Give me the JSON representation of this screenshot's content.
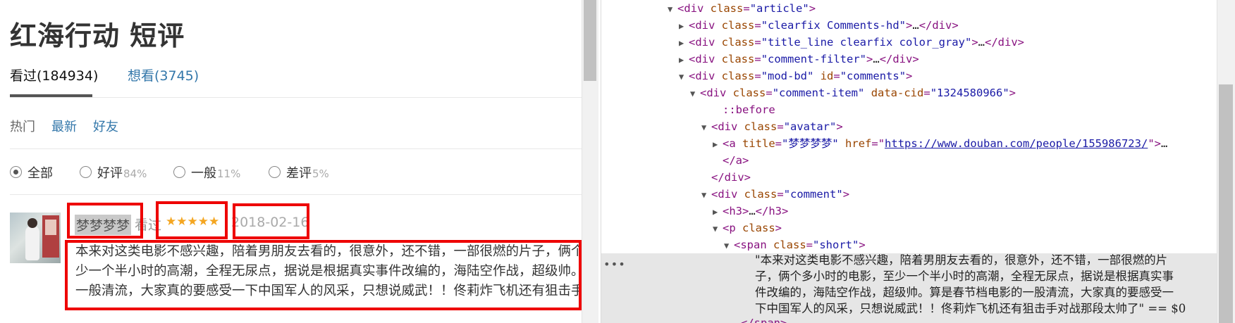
{
  "page": {
    "title": "红海行动 短评",
    "tabs": [
      {
        "label": "看过(184934)",
        "active": true
      },
      {
        "label": "想看(3745)",
        "active": false
      }
    ],
    "sort_links": [
      "热门",
      "最新",
      "好友"
    ],
    "filters": [
      {
        "label": "全部",
        "pct": "",
        "selected": true
      },
      {
        "label": "好评",
        "pct": "84%",
        "selected": false
      },
      {
        "label": "一般",
        "pct": "11%",
        "selected": false
      },
      {
        "label": "差评",
        "pct": "5%",
        "selected": false
      }
    ]
  },
  "comment": {
    "user": "梦梦梦梦",
    "status": "看过",
    "rating": 5,
    "rating_max": 5,
    "stars": "★★★★★",
    "date": "2018-02-16",
    "text_lines": [
      "本来对这类电影不感兴趣，陪着男朋友去看的，很意外，还不错，一部很燃的片子，俩个多小时的电影，至",
      "少一个半小时的高潮，全程无尿点，据说是根据真实事件改编的，海陆空作战，超级帅。算是春节档电影的",
      "一般清流，大家真的要感受一下中国军人的风采，只想说威武！！佟莉炸飞机还有狙击手对战那段太帅了"
    ]
  },
  "devtools": {
    "lines": [
      {
        "tri": "▼",
        "parts": [
          [
            "tag",
            "<div "
          ],
          [
            "an",
            "class"
          ],
          [
            "tag",
            "="
          ],
          [
            "av",
            "\"article\""
          ],
          [
            "tag",
            ">"
          ]
        ]
      },
      {
        "tri": "▶",
        "parts": [
          [
            "tag",
            "<div "
          ],
          [
            "an",
            "class"
          ],
          [
            "tag",
            "="
          ],
          [
            "av",
            "\"clearfix Comments-hd\""
          ],
          [
            "tag",
            ">"
          ],
          [
            "txt",
            "…"
          ],
          [
            "tag",
            "</div>"
          ]
        ]
      },
      {
        "tri": "▶",
        "parts": [
          [
            "tag",
            "<div "
          ],
          [
            "an",
            "class"
          ],
          [
            "tag",
            "="
          ],
          [
            "av",
            "\"title_line clearfix color_gray\""
          ],
          [
            "tag",
            ">"
          ],
          [
            "txt",
            "…"
          ],
          [
            "tag",
            "</div>"
          ]
        ]
      },
      {
        "tri": "▶",
        "parts": [
          [
            "tag",
            "<div "
          ],
          [
            "an",
            "class"
          ],
          [
            "tag",
            "="
          ],
          [
            "av",
            "\"comment-filter\""
          ],
          [
            "tag",
            ">"
          ],
          [
            "txt",
            "…"
          ],
          [
            "tag",
            "</div>"
          ]
        ]
      },
      {
        "tri": "▼",
        "parts": [
          [
            "tag",
            "<div "
          ],
          [
            "an",
            "class"
          ],
          [
            "tag",
            "="
          ],
          [
            "av",
            "\"mod-bd\""
          ],
          [
            "tag",
            " "
          ],
          [
            "an",
            "id"
          ],
          [
            "tag",
            "="
          ],
          [
            "av",
            "\"comments\""
          ],
          [
            "tag",
            ">"
          ]
        ]
      },
      {
        "tri": "▼",
        "parts": [
          [
            "tag",
            "<div "
          ],
          [
            "an",
            "class"
          ],
          [
            "tag",
            "="
          ],
          [
            "av",
            "\"comment-item\""
          ],
          [
            "tag",
            " "
          ],
          [
            "an",
            "data-cid"
          ],
          [
            "tag",
            "="
          ],
          [
            "av",
            "\"1324580966\""
          ],
          [
            "tag",
            ">"
          ]
        ]
      },
      {
        "tri": "",
        "parts": [
          [
            "pseudo",
            "::before"
          ]
        ]
      },
      {
        "tri": "▼",
        "parts": [
          [
            "tag",
            "<div "
          ],
          [
            "an",
            "class"
          ],
          [
            "tag",
            "="
          ],
          [
            "av",
            "\"avatar\""
          ],
          [
            "tag",
            ">"
          ]
        ]
      },
      {
        "tri": "▶",
        "parts": [
          [
            "tag",
            "<a "
          ],
          [
            "an",
            "title"
          ],
          [
            "tag",
            "="
          ],
          [
            "av",
            "\"梦梦梦梦\""
          ],
          [
            "tag",
            " "
          ],
          [
            "an",
            "href"
          ],
          [
            "tag",
            "=\""
          ],
          [
            "link",
            "https://www.douban.com/people/155986723/"
          ],
          [
            "tag",
            "\">"
          ],
          [
            "txt",
            "…"
          ]
        ]
      },
      {
        "tri": "",
        "parts": [
          [
            "tag",
            "</a>"
          ]
        ]
      },
      {
        "tri": "",
        "parts": [
          [
            "tag",
            "</div>"
          ]
        ]
      },
      {
        "tri": "▼",
        "parts": [
          [
            "tag",
            "<div "
          ],
          [
            "an",
            "class"
          ],
          [
            "tag",
            "="
          ],
          [
            "av",
            "\"comment\""
          ],
          [
            "tag",
            ">"
          ]
        ]
      },
      {
        "tri": "▶",
        "parts": [
          [
            "tag",
            "<h3>"
          ],
          [
            "txt",
            "…"
          ],
          [
            "tag",
            "</h3>"
          ]
        ]
      },
      {
        "tri": "▼",
        "parts": [
          [
            "tag",
            "<p "
          ],
          [
            "an",
            "class"
          ],
          [
            "tag",
            ">"
          ]
        ]
      },
      {
        "tri": "▼",
        "parts": [
          [
            "tag",
            "<span "
          ],
          [
            "an",
            "class"
          ],
          [
            "tag",
            "="
          ],
          [
            "av",
            "\"short\""
          ],
          [
            "tag",
            ">"
          ]
        ]
      }
    ],
    "dots": "•••",
    "string_lines": [
      "\"本来对这类电影不感兴趣，陪着男朋友去看的，很意外，还不错，一部很燃的片",
      "子，俩个多小时的电影，至少一个半小时的高潮，全程无尿点，据说是根据真实事",
      "件改编的，海陆空作战，超级帅。算是春节档电影的一股清流，大家真的要感受一",
      "下中国军人的风采，只想说威武！！佟莉炸飞机还有狙击手对战那段太帅了\" == $0"
    ],
    "last_line": "</span>"
  }
}
